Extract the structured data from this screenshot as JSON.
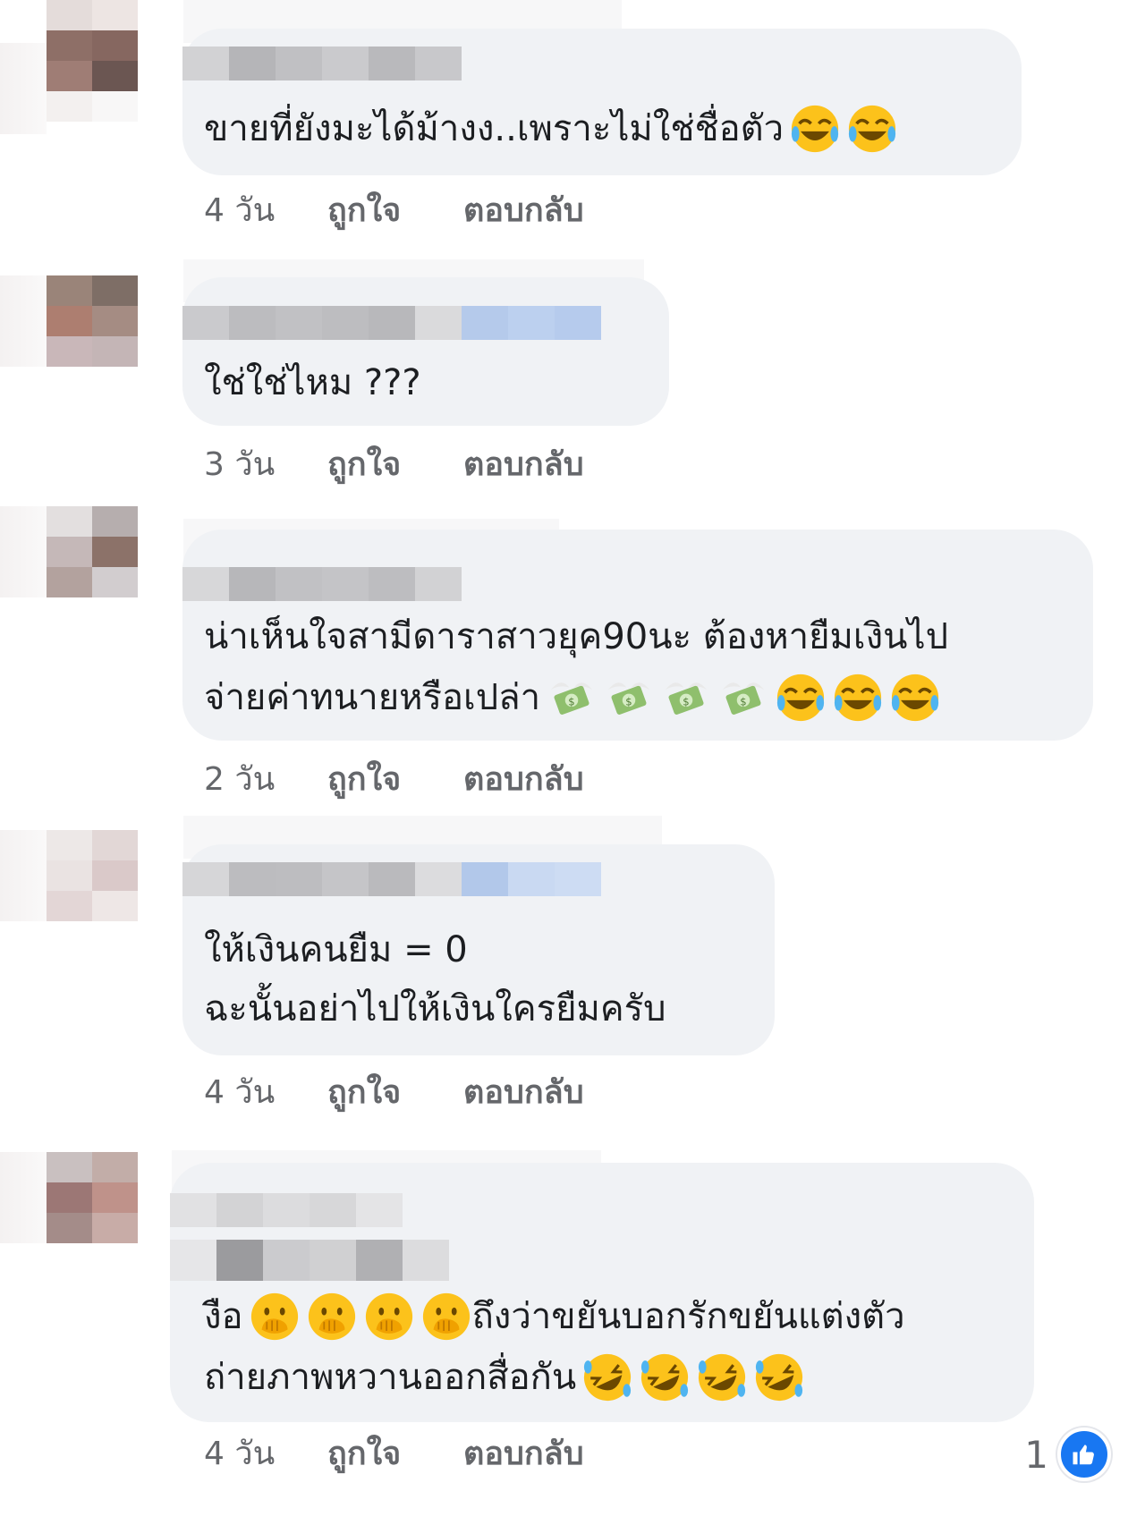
{
  "comments": [
    {
      "lines": [
        "ขายที่ยังมะได้ม้างง..เพราะไม่ใช่ชื่อตัว"
      ],
      "emojis": [
        [
          "joy-face",
          "joy-face"
        ]
      ],
      "time": "4 วัน",
      "like_label": "ถูกใจ",
      "reply_label": "ตอบกลับ"
    },
    {
      "lines": [
        "ใช่ใช่ไหม ???"
      ],
      "emojis": [
        []
      ],
      "time": "3 วัน",
      "like_label": "ถูกใจ",
      "reply_label": "ตอบกลับ"
    },
    {
      "lines": [
        "น่าเห็นใจสามีดาราสาวยุค90นะ ต้องหายืมเงินไป",
        "จ่ายค่าทนายหรือเปล่า"
      ],
      "emojis": [
        [],
        [
          "money-wings",
          "money-wings",
          "money-wings",
          "money-wings",
          "joy-face",
          "joy-face",
          "joy-face"
        ]
      ],
      "time": "2 วัน",
      "like_label": "ถูกใจ",
      "reply_label": "ตอบกลับ"
    },
    {
      "lines": [
        "ให้เงินคนยืม = 0",
        "ฉะนั้นอย่าไปให้เงินใครยืมครับ"
      ],
      "emojis": [
        [],
        []
      ],
      "time": "4 วัน",
      "like_label": "ถูกใจ",
      "reply_label": "ตอบกลับ"
    },
    {
      "lines": [
        "ถึงว่าขยันบอกรักขยันแต่งตัว",
        "ถ่ายภาพหวานออกสื่อกัน"
      ],
      "prefix": "งือ",
      "time": "4 วัน",
      "like_label": "ถูกใจ",
      "reply_label": "ตอบกลับ",
      "reaction_count": "1"
    }
  ],
  "colors": {
    "bubble": "#f0f2f5",
    "meta_text": "#65676b",
    "like_blue": "#1877f2"
  }
}
